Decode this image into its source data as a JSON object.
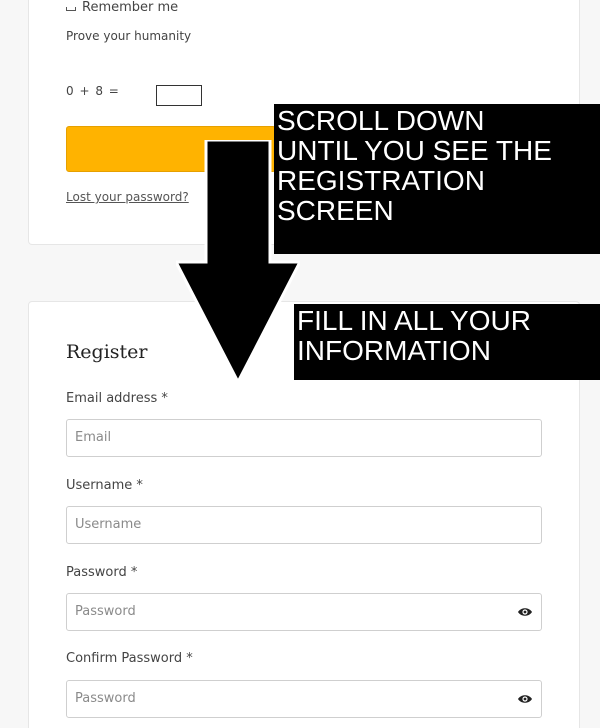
{
  "login": {
    "remember_label": "Remember me",
    "humanity_label": "Prove your humanity",
    "captcha_text": "0 + 8 =",
    "captcha_value": "",
    "lost_password": "Lost your password?"
  },
  "overlay": {
    "top_lines": [
      "SCROLL DOWN",
      "UNTIL YOU SEE THE",
      "REGISTRATION",
      "SCREEN"
    ],
    "bottom_lines": [
      "FILL IN ALL YOUR",
      "INFORMATION"
    ]
  },
  "register": {
    "title": "Register",
    "email_label": "Email address *",
    "email_placeholder": "Email",
    "username_label": "Username *",
    "username_placeholder": "Username",
    "password_label": "Password *",
    "password_placeholder": "Password",
    "confirm_label": "Confirm Password *",
    "confirm_placeholder": "Password"
  },
  "icons": {
    "eye": "eye-icon",
    "arrow": "arrow-down-icon"
  },
  "colors": {
    "login_button": "#ffb300",
    "overlay_bg": "#000000",
    "overlay_text": "#ffffff"
  }
}
